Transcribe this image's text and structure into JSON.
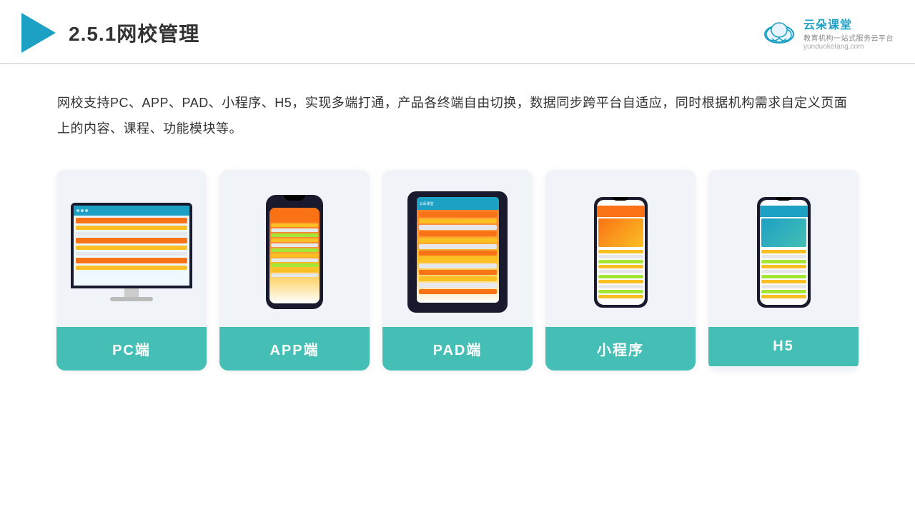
{
  "header": {
    "title": "2.5.1网校管理",
    "brand": {
      "name": "云朵课堂",
      "url": "yunduoketang.com",
      "tagline": "教育机构一站式服务云平台"
    }
  },
  "description": {
    "text": "网校支持PC、APP、PAD、小程序、H5，实现多端打通，产品各终端自由切换，数据同步跨平台自适应，同时根据机构需求自定义页面上的内容、课程、功能模块等。"
  },
  "cards": [
    {
      "id": "pc",
      "label": "PC端"
    },
    {
      "id": "app",
      "label": "APP端"
    },
    {
      "id": "pad",
      "label": "PAD端"
    },
    {
      "id": "mini",
      "label": "小程序"
    },
    {
      "id": "h5",
      "label": "H5"
    }
  ],
  "colors": {
    "accent": "#1ca0c4",
    "teal": "#45bfb5",
    "orange": "#f97316"
  }
}
